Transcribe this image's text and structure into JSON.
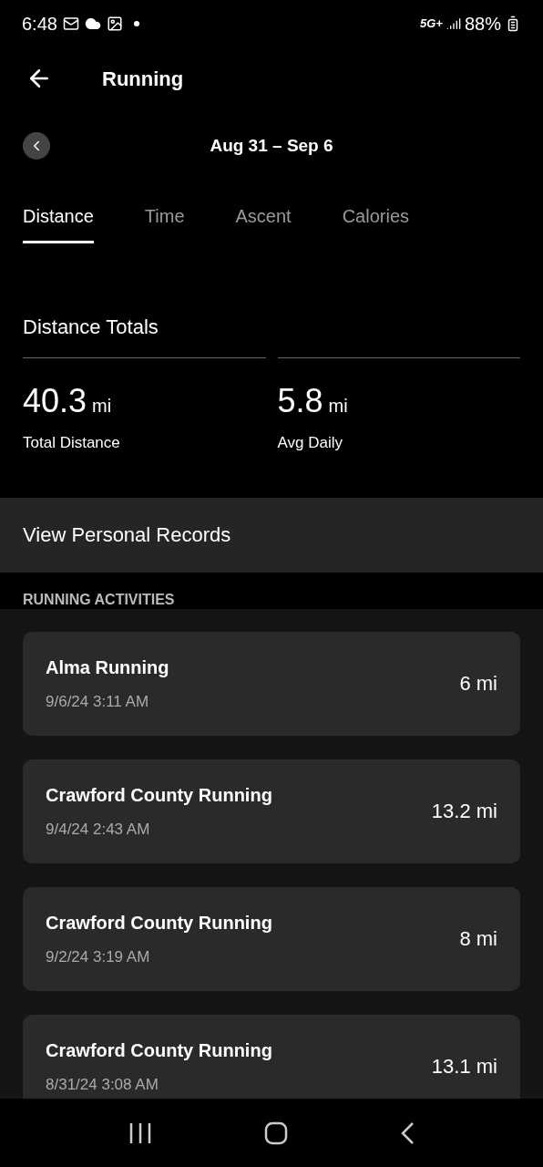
{
  "status_bar": {
    "time": "6:48",
    "network": "5G+",
    "battery": "88%"
  },
  "header": {
    "title": "Running"
  },
  "date_range": "Aug 31 – Sep 6",
  "tabs": [
    {
      "label": "Distance",
      "selected": true
    },
    {
      "label": "Time",
      "selected": false
    },
    {
      "label": "Ascent",
      "selected": false
    },
    {
      "label": "Calories",
      "selected": false
    }
  ],
  "totals": {
    "title": "Distance Totals",
    "stats": [
      {
        "value": "40.3",
        "unit": "mi",
        "label": "Total Distance"
      },
      {
        "value": "5.8",
        "unit": "mi",
        "label": "Avg Daily"
      }
    ]
  },
  "personal_records": "View Personal Records",
  "activities": {
    "heading": "RUNNING ACTIVITIES",
    "items": [
      {
        "name": "Alma Running",
        "date": "9/6/24 3:11 AM",
        "distance": "6 mi"
      },
      {
        "name": "Crawford County Running",
        "date": "9/4/24 2:43 AM",
        "distance": "13.2 mi"
      },
      {
        "name": "Crawford County Running",
        "date": "9/2/24 3:19 AM",
        "distance": "8 mi"
      },
      {
        "name": "Crawford County Running",
        "date": "8/31/24 3:08 AM",
        "distance": "13.1 mi"
      }
    ]
  }
}
